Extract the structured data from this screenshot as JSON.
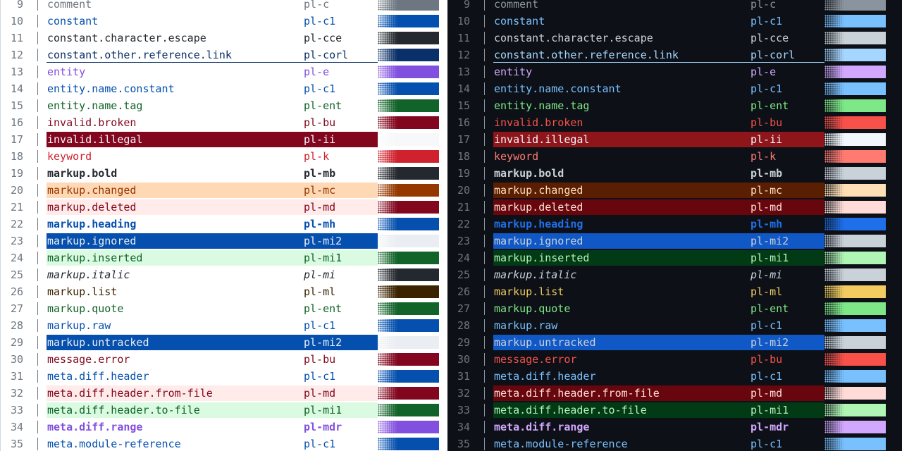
{
  "rows": [
    {
      "n": "9",
      "name": "comment",
      "cls": "pl-c",
      "light": {
        "fg": "#6e7781"
      },
      "dark": {
        "fg": "#8b949e"
      }
    },
    {
      "n": "10",
      "name": "constant",
      "cls": "pl-c1",
      "light": {
        "fg": "#0550ae"
      },
      "dark": {
        "fg": "#79c0ff"
      }
    },
    {
      "n": "11",
      "name": "constant.character.escape",
      "cls": "pl-cce",
      "light": {
        "fg": "#24292f"
      },
      "dark": {
        "fg": "#c9d1d9"
      }
    },
    {
      "n": "12",
      "name": "constant.other.reference.link",
      "cls": "pl-corl",
      "underline": true,
      "light": {
        "fg": "#0a3069"
      },
      "dark": {
        "fg": "#a5d6ff"
      }
    },
    {
      "n": "13",
      "name": "entity",
      "cls": "pl-e",
      "light": {
        "fg": "#8250df"
      },
      "dark": {
        "fg": "#d2a8ff"
      }
    },
    {
      "n": "14",
      "name": "entity.name.constant",
      "cls": "pl-c1",
      "light": {
        "fg": "#0550ae"
      },
      "dark": {
        "fg": "#79c0ff"
      }
    },
    {
      "n": "15",
      "name": "entity.name.tag",
      "cls": "pl-ent",
      "light": {
        "fg": "#116329"
      },
      "dark": {
        "fg": "#7ee787"
      }
    },
    {
      "n": "16",
      "name": "invalid.broken",
      "cls": "pl-bu",
      "light": {
        "fg": "#82071e"
      },
      "dark": {
        "fg": "#f85149"
      }
    },
    {
      "n": "17",
      "name": "invalid.illegal",
      "cls": "pl-ii",
      "light": {
        "fg": "#f6f8fa",
        "bg": "#82071e"
      },
      "dark": {
        "fg": "#f0f6fc",
        "bg": "#8e1519"
      }
    },
    {
      "n": "18",
      "name": "keyword",
      "cls": "pl-k",
      "light": {
        "fg": "#cf222e"
      },
      "dark": {
        "fg": "#ff7b72"
      }
    },
    {
      "n": "19",
      "name": "markup.bold",
      "cls": "pl-mb",
      "bold": true,
      "light": {
        "fg": "#24292f"
      },
      "dark": {
        "fg": "#c9d1d9"
      }
    },
    {
      "n": "20",
      "name": "markup.changed",
      "cls": "pl-mc",
      "light": {
        "fg": "#953800",
        "bg": "#ffd8b5"
      },
      "dark": {
        "fg": "#ffdfb6",
        "bg": "#5a1e02"
      }
    },
    {
      "n": "21",
      "name": "markup.deleted",
      "cls": "pl-md",
      "light": {
        "fg": "#82071e",
        "bg": "#ffebe9"
      },
      "dark": {
        "fg": "#ffdcd7",
        "bg": "#67060c"
      }
    },
    {
      "n": "22",
      "name": "markup.heading",
      "cls": "pl-mh",
      "bold": true,
      "light": {
        "fg": "#0550ae"
      },
      "dark": {
        "fg": "#1f6feb"
      }
    },
    {
      "n": "23",
      "name": "markup.ignored",
      "cls": "pl-mi2",
      "light": {
        "fg": "#eaeef2",
        "bg": "#0550ae"
      },
      "dark": {
        "fg": "#c9d1d9",
        "bg": "#1158c7"
      }
    },
    {
      "n": "24",
      "name": "markup.inserted",
      "cls": "pl-mi1",
      "light": {
        "fg": "#116329",
        "bg": "#dafbe1"
      },
      "dark": {
        "fg": "#aff5b4",
        "bg": "#033a16"
      }
    },
    {
      "n": "25",
      "name": "markup.italic",
      "cls": "pl-mi",
      "italic": true,
      "light": {
        "fg": "#24292f"
      },
      "dark": {
        "fg": "#c9d1d9"
      }
    },
    {
      "n": "26",
      "name": "markup.list",
      "cls": "pl-ml",
      "light": {
        "fg": "#3b2300"
      },
      "dark": {
        "fg": "#f2cc60"
      }
    },
    {
      "n": "27",
      "name": "markup.quote",
      "cls": "pl-ent",
      "light": {
        "fg": "#116329"
      },
      "dark": {
        "fg": "#7ee787"
      }
    },
    {
      "n": "28",
      "name": "markup.raw",
      "cls": "pl-c1",
      "light": {
        "fg": "#0550ae"
      },
      "dark": {
        "fg": "#79c0ff"
      }
    },
    {
      "n": "29",
      "name": "markup.untracked",
      "cls": "pl-mi2",
      "light": {
        "fg": "#eaeef2",
        "bg": "#0550ae"
      },
      "dark": {
        "fg": "#c9d1d9",
        "bg": "#1158c7"
      }
    },
    {
      "n": "30",
      "name": "message.error",
      "cls": "pl-bu",
      "light": {
        "fg": "#82071e"
      },
      "dark": {
        "fg": "#f85149"
      }
    },
    {
      "n": "31",
      "name": "meta.diff.header",
      "cls": "pl-c1",
      "light": {
        "fg": "#0550ae"
      },
      "dark": {
        "fg": "#79c0ff"
      }
    },
    {
      "n": "32",
      "name": "meta.diff.header.from-file",
      "cls": "pl-md",
      "light": {
        "fg": "#82071e",
        "bg": "#ffebe9"
      },
      "dark": {
        "fg": "#ffdcd7",
        "bg": "#67060c"
      }
    },
    {
      "n": "33",
      "name": "meta.diff.header.to-file",
      "cls": "pl-mi1",
      "light": {
        "fg": "#116329",
        "bg": "#dafbe1"
      },
      "dark": {
        "fg": "#aff5b4",
        "bg": "#033a16"
      }
    },
    {
      "n": "34",
      "name": "meta.diff.range",
      "cls": "pl-mdr",
      "bold": true,
      "light": {
        "fg": "#8250df"
      },
      "dark": {
        "fg": "#d2a8ff"
      }
    },
    {
      "n": "35",
      "name": "meta.module-reference",
      "cls": "pl-c1",
      "light": {
        "fg": "#0550ae"
      },
      "dark": {
        "fg": "#79c0ff"
      }
    }
  ]
}
